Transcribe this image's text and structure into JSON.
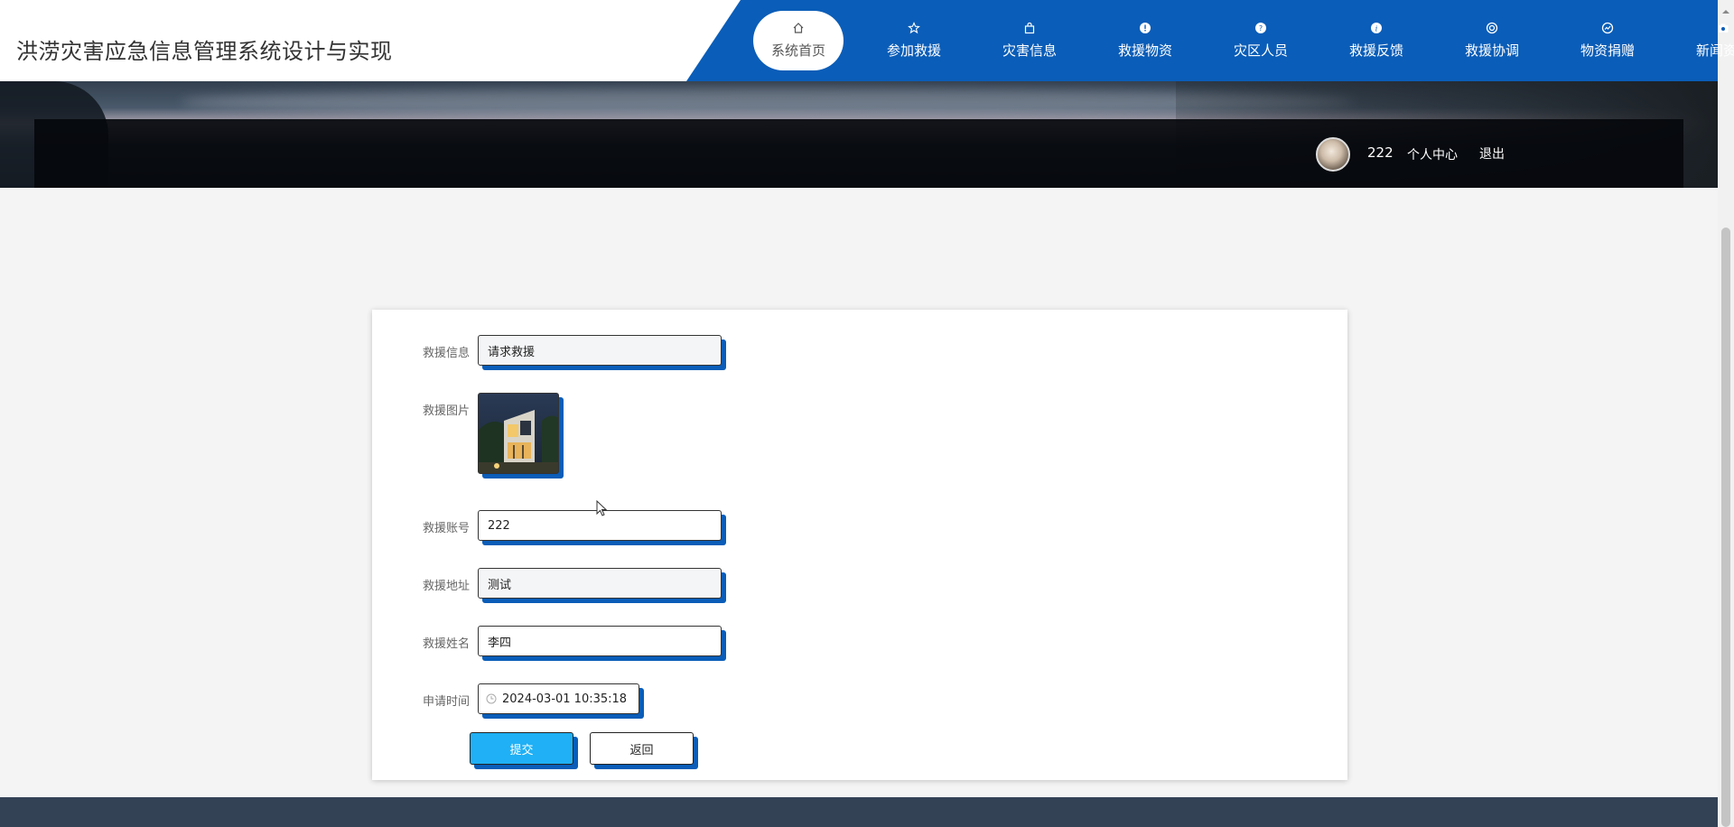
{
  "header": {
    "site_title": "洪涝灾害应急信息管理系统设计与实现",
    "nav": [
      {
        "label": "系统首页",
        "icon": "home-icon",
        "active": true
      },
      {
        "label": "参加救援",
        "icon": "star-icon"
      },
      {
        "label": "灾害信息",
        "icon": "bag-icon"
      },
      {
        "label": "救援物资",
        "icon": "alert-circle-icon"
      },
      {
        "label": "灾区人员",
        "icon": "help-circle-icon"
      },
      {
        "label": "救援反馈",
        "icon": "info-circle-icon"
      },
      {
        "label": "救援协调",
        "icon": "lifebuoy-icon"
      },
      {
        "label": "物资捐赠",
        "icon": "gauge-icon"
      },
      {
        "label": "新闻资讯",
        "icon": "camera-icon"
      }
    ]
  },
  "userbar": {
    "username": "222",
    "center_label": "个人中心",
    "logout_label": "退出"
  },
  "form": {
    "rescue_info_label": "救援信息",
    "rescue_info_value": "请求救援",
    "rescue_image_label": "救援图片",
    "rescue_account_label": "救援账号",
    "rescue_account_value": "222",
    "rescue_address_label": "救援地址",
    "rescue_address_value": "测试",
    "rescue_name_label": "救援姓名",
    "rescue_name_value": "李四",
    "apply_time_label": "申请时间",
    "apply_time_value": "2024-03-01 10:35:18",
    "submit_label": "提交",
    "back_label": "返回"
  },
  "colors": {
    "nav_blue": "#0a5db8",
    "submit_blue": "#1fb0f5",
    "footer": "#344255"
  }
}
